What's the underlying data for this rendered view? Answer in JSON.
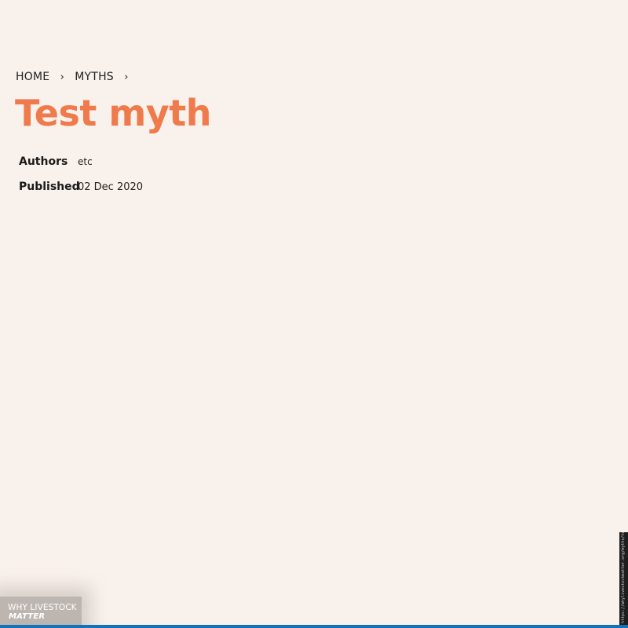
{
  "breadcrumb": {
    "items": [
      {
        "label": "HOME"
      },
      {
        "label": "MYTHS"
      }
    ],
    "separator": "›"
  },
  "page": {
    "title": "Test myth"
  },
  "meta": {
    "authors_label": "Authors",
    "authors_value": "etc",
    "published_label": "Published",
    "published_value": "02 Dec 2020"
  },
  "logo": {
    "line1": "WHY LIVESTOCK",
    "line2": "MATTER"
  },
  "url_strip": {
    "text": "https://whylivestockmatter.org/myths/test-myth"
  },
  "colors": {
    "background": "#f9f1eb",
    "title": "#ef7b4d",
    "bottom_bar": "#1672b8"
  }
}
